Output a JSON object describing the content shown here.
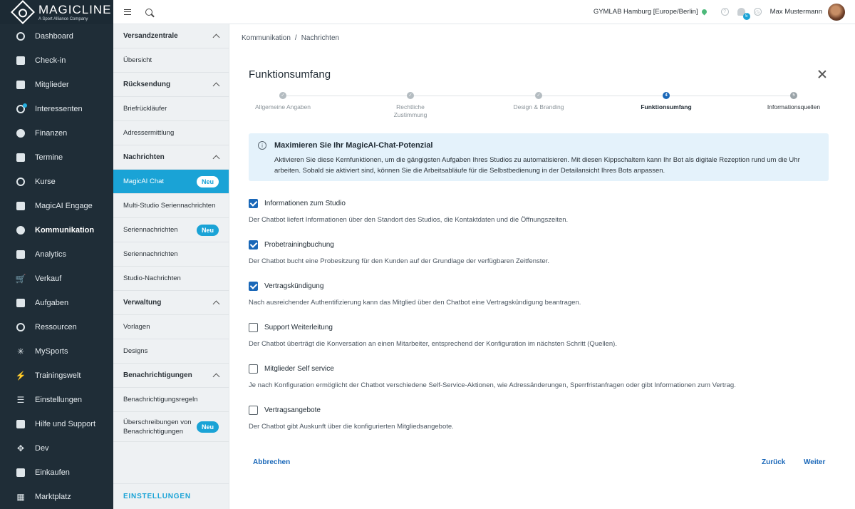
{
  "brand": {
    "name": "MAGICLINE",
    "tagline": "A Sport Alliance Company"
  },
  "sidebar": {
    "items": [
      {
        "label": "Dashboard",
        "icon": "dashboard-icon"
      },
      {
        "label": "Check-in",
        "icon": "checkin-icon"
      },
      {
        "label": "Mitglieder",
        "icon": "members-icon"
      },
      {
        "label": "Interessenten",
        "icon": "prospects-icon"
      },
      {
        "label": "Finanzen",
        "icon": "finance-icon"
      },
      {
        "label": "Termine",
        "icon": "calendar-icon"
      },
      {
        "label": "Kurse",
        "icon": "courses-icon"
      },
      {
        "label": "MagicAI Engage",
        "icon": "engage-icon"
      },
      {
        "label": "Kommunikation",
        "icon": "chat-icon"
      },
      {
        "label": "Analytics",
        "icon": "analytics-icon"
      },
      {
        "label": "Verkauf",
        "icon": "cart-icon"
      },
      {
        "label": "Aufgaben",
        "icon": "tasks-icon"
      },
      {
        "label": "Ressourcen",
        "icon": "resources-icon"
      },
      {
        "label": "MySports",
        "icon": "mysports-icon"
      },
      {
        "label": "Trainingswelt",
        "icon": "training-icon"
      },
      {
        "label": "Einstellungen",
        "icon": "settings-icon"
      },
      {
        "label": "Hilfe und Support",
        "icon": "help-icon"
      },
      {
        "label": "Dev",
        "icon": "dev-icon"
      },
      {
        "label": "Einkaufen",
        "icon": "shopping-icon"
      },
      {
        "label": "Marktplatz",
        "icon": "marketplace-icon"
      }
    ]
  },
  "subnav": {
    "sections": {
      "versand": {
        "title": "Versandzentrale",
        "items": [
          "Übersicht"
        ]
      },
      "ruecksendung": {
        "title": "Rücksendung",
        "items": [
          "Briefrückläufer",
          "Adressermittlung"
        ]
      },
      "nachrichten": {
        "title": "Nachrichten",
        "items": [
          "MagicAI Chat",
          "Multi-Studio Seriennachrichten",
          "Seriennachrichten",
          "Seriennachrichten",
          "Studio-Nachrichten"
        ]
      },
      "verwaltung": {
        "title": "Verwaltung",
        "items": [
          "Vorlagen",
          "Designs"
        ]
      },
      "benachrichtigungen": {
        "title": "Benachrichtigungen",
        "items": [
          "Benachrichtigungsregeln",
          "Überschreibungen von",
          "Benachrichtigungen"
        ]
      }
    },
    "badge": "Neu",
    "settings_link": "EINSTELLUNGEN"
  },
  "topbar": {
    "studio": "GYMLAB Hamburg [Europe/Berlin]",
    "notification_count": "5",
    "user_name": "Max Mustermann"
  },
  "breadcrumb": [
    "Kommunikation",
    "/",
    "Nachrichten"
  ],
  "page": {
    "title": "Funktionsumfang"
  },
  "stepper": {
    "steps": [
      {
        "label": "Allgemeine Angaben",
        "marker": "✓"
      },
      {
        "label": "Rechtliche Zustimmung",
        "marker": "✓"
      },
      {
        "label": "Design & Branding",
        "marker": "✓"
      },
      {
        "label": "Funktionsumfang",
        "marker": "4"
      },
      {
        "label": "Informationsquellen",
        "marker": "5"
      }
    ]
  },
  "info": {
    "title": "Maximieren Sie Ihr MagicAI-Chat-Potenzial",
    "text": "Aktivieren Sie diese Kernfunktionen, um die gängigsten Aufgaben Ihres Studios zu automatisieren. Mit diesen Kippschaltern kann Ihr Bot als digitale Rezeption rund um die Uhr arbeiten. Sobald sie aktiviert sind, können Sie die Arbeitsabläufe für die Selbstbedienung in der Detailansicht Ihres Bots anpassen."
  },
  "features": [
    {
      "label": "Informationen zum Studio",
      "checked": true,
      "desc": "Der Chatbot liefert Informationen über den Standort des Studios, die Kontaktdaten und die Öffnungszeiten."
    },
    {
      "label": "Probetrainingbuchung",
      "checked": true,
      "desc": "Der Chatbot bucht eine Probesitzung für den Kunden auf der Grundlage der verfügbaren Zeitfenster."
    },
    {
      "label": "Vertragskündigung",
      "checked": true,
      "desc": "Nach ausreichender Authentifizierung kann das Mitglied über den Chatbot eine Vertragskündigung beantragen."
    },
    {
      "label": "Support Weiterleitung",
      "checked": false,
      "desc": "Der Chatbot überträgt die Konversation an einen Mitarbeiter, entsprechend der Konfiguration im nächsten Schritt (Quellen)."
    },
    {
      "label": "Mitglieder Self service",
      "checked": false,
      "desc": "Je nach Konfiguration ermöglicht der Chatbot verschiedene Self-Service-Aktionen, wie Adressänderungen, Sperrfristanfragen oder gibt Informationen zum Vertrag."
    },
    {
      "label": "Vertragsangebote",
      "checked": false,
      "desc": "Der Chatbot gibt Auskunft über die konfigurierten Mitgliedsangebote."
    }
  ],
  "actions": {
    "cancel": "Abbrechen",
    "back": "Zurück",
    "next": "Weiter"
  },
  "colors": {
    "sidebar": "#1f2d37",
    "accent": "#1aa3d6",
    "primary": "#1967b8",
    "info_bg": "#e4f2fb"
  }
}
